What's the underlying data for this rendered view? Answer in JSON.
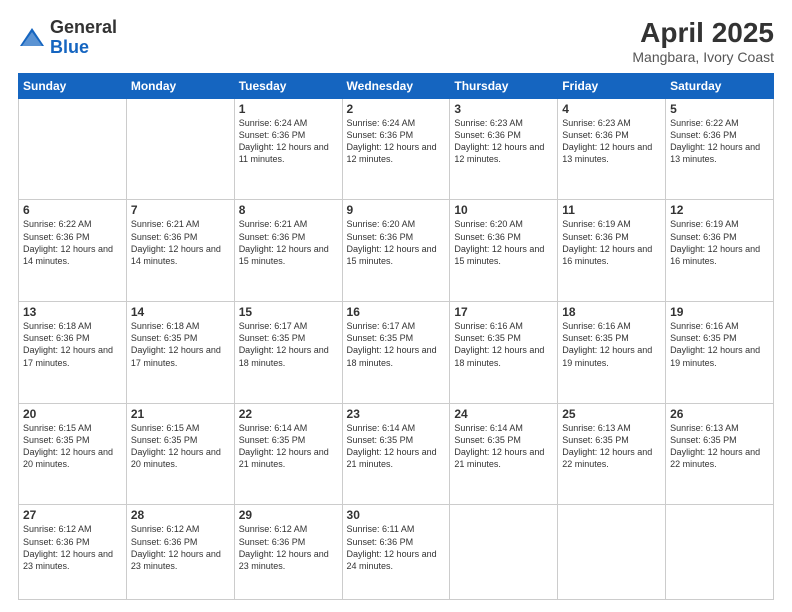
{
  "header": {
    "logo_general": "General",
    "logo_blue": "Blue",
    "title": "April 2025",
    "subtitle": "Mangbara, Ivory Coast"
  },
  "calendar": {
    "days_of_week": [
      "Sunday",
      "Monday",
      "Tuesday",
      "Wednesday",
      "Thursday",
      "Friday",
      "Saturday"
    ],
    "weeks": [
      [
        {
          "day": "",
          "info": ""
        },
        {
          "day": "",
          "info": ""
        },
        {
          "day": "1",
          "info": "Sunrise: 6:24 AM\nSunset: 6:36 PM\nDaylight: 12 hours and 11 minutes."
        },
        {
          "day": "2",
          "info": "Sunrise: 6:24 AM\nSunset: 6:36 PM\nDaylight: 12 hours and 12 minutes."
        },
        {
          "day": "3",
          "info": "Sunrise: 6:23 AM\nSunset: 6:36 PM\nDaylight: 12 hours and 12 minutes."
        },
        {
          "day": "4",
          "info": "Sunrise: 6:23 AM\nSunset: 6:36 PM\nDaylight: 12 hours and 13 minutes."
        },
        {
          "day": "5",
          "info": "Sunrise: 6:22 AM\nSunset: 6:36 PM\nDaylight: 12 hours and 13 minutes."
        }
      ],
      [
        {
          "day": "6",
          "info": "Sunrise: 6:22 AM\nSunset: 6:36 PM\nDaylight: 12 hours and 14 minutes."
        },
        {
          "day": "7",
          "info": "Sunrise: 6:21 AM\nSunset: 6:36 PM\nDaylight: 12 hours and 14 minutes."
        },
        {
          "day": "8",
          "info": "Sunrise: 6:21 AM\nSunset: 6:36 PM\nDaylight: 12 hours and 15 minutes."
        },
        {
          "day": "9",
          "info": "Sunrise: 6:20 AM\nSunset: 6:36 PM\nDaylight: 12 hours and 15 minutes."
        },
        {
          "day": "10",
          "info": "Sunrise: 6:20 AM\nSunset: 6:36 PM\nDaylight: 12 hours and 15 minutes."
        },
        {
          "day": "11",
          "info": "Sunrise: 6:19 AM\nSunset: 6:36 PM\nDaylight: 12 hours and 16 minutes."
        },
        {
          "day": "12",
          "info": "Sunrise: 6:19 AM\nSunset: 6:36 PM\nDaylight: 12 hours and 16 minutes."
        }
      ],
      [
        {
          "day": "13",
          "info": "Sunrise: 6:18 AM\nSunset: 6:36 PM\nDaylight: 12 hours and 17 minutes."
        },
        {
          "day": "14",
          "info": "Sunrise: 6:18 AM\nSunset: 6:35 PM\nDaylight: 12 hours and 17 minutes."
        },
        {
          "day": "15",
          "info": "Sunrise: 6:17 AM\nSunset: 6:35 PM\nDaylight: 12 hours and 18 minutes."
        },
        {
          "day": "16",
          "info": "Sunrise: 6:17 AM\nSunset: 6:35 PM\nDaylight: 12 hours and 18 minutes."
        },
        {
          "day": "17",
          "info": "Sunrise: 6:16 AM\nSunset: 6:35 PM\nDaylight: 12 hours and 18 minutes."
        },
        {
          "day": "18",
          "info": "Sunrise: 6:16 AM\nSunset: 6:35 PM\nDaylight: 12 hours and 19 minutes."
        },
        {
          "day": "19",
          "info": "Sunrise: 6:16 AM\nSunset: 6:35 PM\nDaylight: 12 hours and 19 minutes."
        }
      ],
      [
        {
          "day": "20",
          "info": "Sunrise: 6:15 AM\nSunset: 6:35 PM\nDaylight: 12 hours and 20 minutes."
        },
        {
          "day": "21",
          "info": "Sunrise: 6:15 AM\nSunset: 6:35 PM\nDaylight: 12 hours and 20 minutes."
        },
        {
          "day": "22",
          "info": "Sunrise: 6:14 AM\nSunset: 6:35 PM\nDaylight: 12 hours and 21 minutes."
        },
        {
          "day": "23",
          "info": "Sunrise: 6:14 AM\nSunset: 6:35 PM\nDaylight: 12 hours and 21 minutes."
        },
        {
          "day": "24",
          "info": "Sunrise: 6:14 AM\nSunset: 6:35 PM\nDaylight: 12 hours and 21 minutes."
        },
        {
          "day": "25",
          "info": "Sunrise: 6:13 AM\nSunset: 6:35 PM\nDaylight: 12 hours and 22 minutes."
        },
        {
          "day": "26",
          "info": "Sunrise: 6:13 AM\nSunset: 6:35 PM\nDaylight: 12 hours and 22 minutes."
        }
      ],
      [
        {
          "day": "27",
          "info": "Sunrise: 6:12 AM\nSunset: 6:36 PM\nDaylight: 12 hours and 23 minutes."
        },
        {
          "day": "28",
          "info": "Sunrise: 6:12 AM\nSunset: 6:36 PM\nDaylight: 12 hours and 23 minutes."
        },
        {
          "day": "29",
          "info": "Sunrise: 6:12 AM\nSunset: 6:36 PM\nDaylight: 12 hours and 23 minutes."
        },
        {
          "day": "30",
          "info": "Sunrise: 6:11 AM\nSunset: 6:36 PM\nDaylight: 12 hours and 24 minutes."
        },
        {
          "day": "",
          "info": ""
        },
        {
          "day": "",
          "info": ""
        },
        {
          "day": "",
          "info": ""
        }
      ]
    ]
  }
}
